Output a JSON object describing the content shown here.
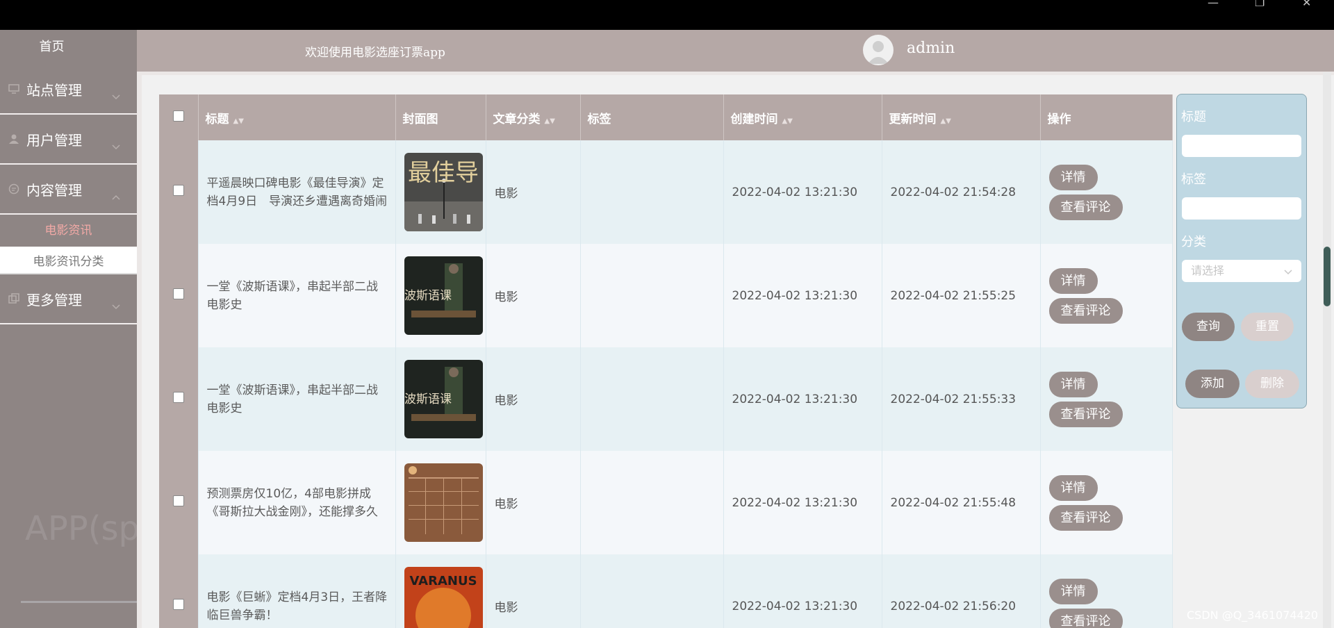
{
  "window": {
    "minimize_glyph": "—",
    "restore_glyph": "❐",
    "close_glyph": "✕"
  },
  "sidebar": {
    "home": "首页",
    "menus": [
      {
        "label": "站点管理",
        "icon": "monitor-icon"
      },
      {
        "label": "用户管理",
        "icon": "user-icon"
      },
      {
        "label": "内容管理",
        "icon": "chat-icon"
      },
      {
        "label": "更多管理",
        "icon": "copy-icon"
      }
    ],
    "sub_items": [
      "电影资讯",
      "电影资讯分类"
    ],
    "watermark": "APP(spring"
  },
  "header": {
    "title": "欢迎使用电影选座订票app",
    "username": "admin"
  },
  "table": {
    "columns": [
      "标题",
      "封面图",
      "文章分类",
      "标签",
      "创建时间",
      "更新时间",
      "操作"
    ],
    "rows": [
      {
        "title": "平遥晨映口碑电影《最佳导演》定档4月9日　导演还乡遭遇离奇婚闹",
        "category": "电影",
        "tag": "",
        "created": "2022-04-02 13:21:30",
        "updated": "2022-04-02 21:54:28",
        "cover_text": "最佳导"
      },
      {
        "title": "一堂《波斯语课》，串起半部二战电影史",
        "category": "电影",
        "tag": "",
        "created": "2022-04-02 13:21:30",
        "updated": "2022-04-02 21:55:25",
        "cover_text": "波斯语课"
      },
      {
        "title": "一堂《波斯语课》，串起半部二战电影史",
        "category": "电影",
        "tag": "",
        "created": "2022-04-02 13:21:30",
        "updated": "2022-04-02 21:55:33",
        "cover_text": "波斯语课"
      },
      {
        "title": "预测票房仅10亿，4部电影拼成《哥斯拉大战金刚》，还能撑多久",
        "category": "电影",
        "tag": "",
        "created": "2022-04-02 13:21:30",
        "updated": "2022-04-02 21:55:48",
        "cover_text": ""
      },
      {
        "title": "电影《巨蜥》定档4月3日，王者降临巨兽争霸！",
        "category": "电影",
        "tag": "",
        "created": "2022-04-02 13:21:30",
        "updated": "2022-04-02 21:56:20",
        "cover_text": "VARANUS"
      }
    ],
    "detail_label": "详情",
    "comment_label": "查看评论"
  },
  "filter": {
    "title_label": "标题",
    "tag_label": "标签",
    "category_label": "分类",
    "select_placeholder": "请选择",
    "query_label": "查询",
    "reset_label": "重置",
    "add_label": "添加",
    "delete_label": "删除"
  },
  "footer_watermark": "CSDN @Q_3461074420"
}
